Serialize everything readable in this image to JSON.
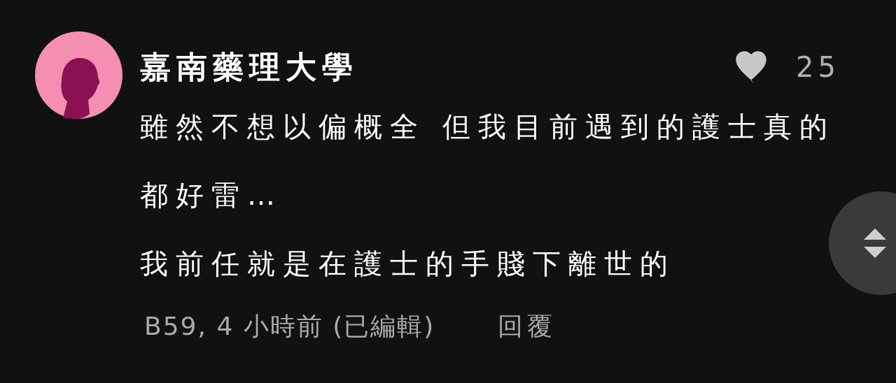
{
  "comment": {
    "author": "嘉南藥理大學",
    "likes": "25",
    "liked": false,
    "paragraphs": [
      "雖然不想以偏概全 但我目前遇到的護士真的都好雷…",
      "我前任就是在護士的手賤下離世的"
    ],
    "meta": "B59, 4 小時前 (已編輯)",
    "reply": "回覆"
  }
}
